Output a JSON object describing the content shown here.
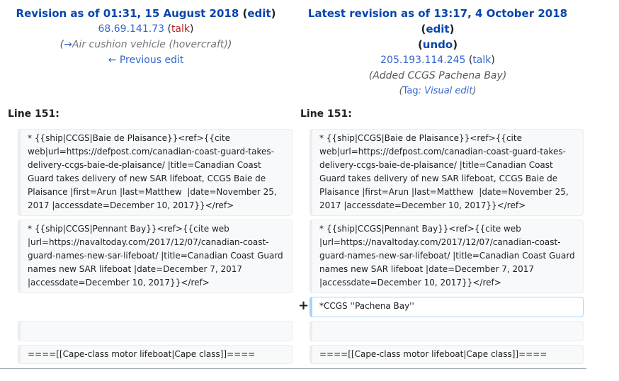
{
  "left_header": {
    "title_prefix": "Revision as of 01:31, 15 August 2018",
    "edit_label": "edit",
    "user": "68.69.141.73",
    "talk_label": "talk",
    "summary_arrow": "→",
    "summary_section": "Air cushion vehicle (hovercraft)",
    "prev_edit_label": "← Previous edit"
  },
  "right_header": {
    "title_prefix": "Latest revision as of 13:17, 4 October 2018",
    "edit_label": "edit",
    "undo_label": "undo",
    "user": "205.193.114.245",
    "talk_label": "talk",
    "summary": "Added CCGS Pachena Bay",
    "tag_label": "Tag",
    "tag_value": "Visual edit"
  },
  "line_labels": {
    "left": "Line 151:",
    "right": "Line 151:"
  },
  "diff": {
    "row1": "* {{ship|CCGS|Baie de Plaisance}}<ref>{{cite web|url=https://defpost.com/canadian-coast-guard-takes-delivery-ccgs-baie-de-plaisance/ |title=Canadian Coast Guard takes delivery of new SAR lifeboat, CCGS Baie de Plaisance |first=Arun |last=Matthew  |date=November 25, 2017 |accessdate=December 10, 2017}}</ref>",
    "row2": "* {{ship|CCGS|Pennant Bay}}<ref>{{cite web |url=https://navaltoday.com/2017/12/07/canadian-coast-guard-names-new-sar-lifeboat/ |title=Canadian Coast Guard names new SAR lifeboat |date=December 7, 2017 |accessdate=December 10, 2017}}</ref>",
    "added_marker": "+",
    "added_line": "*CCGS ''Pachena Bay''",
    "row4": "====[[Cape-class motor lifeboat|Cape class]]===="
  }
}
